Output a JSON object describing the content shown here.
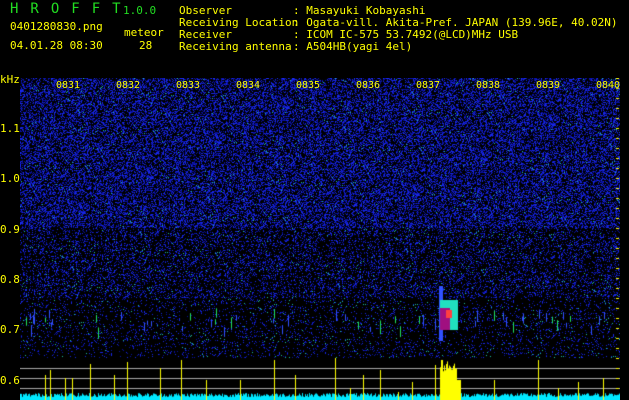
{
  "header": {
    "brand": "HROFFT",
    "version": "1.0.0",
    "filename": "0401280830.png",
    "datetime": "04.01.28 08:30",
    "meteor_label": "meteor",
    "meteor_count": "28"
  },
  "info": [
    {
      "label": "Observer",
      "value": ": Masayuki Kobayashi"
    },
    {
      "label": "Receiving Location",
      "value": ": Ogata-vill. Akita-Pref. JAPAN (139.96E, 40.02N)"
    },
    {
      "label": "Receiver",
      "value": ": ICOM IC-575 53.7492(@LCD)MHz USB"
    },
    {
      "label": "Receiving antenna",
      "value": ": A504HB(yagi 4el)"
    }
  ],
  "spectrogram": {
    "y_unit": "kHz",
    "y_ticks": [
      "1.1",
      "1.0",
      "0.9",
      "0.8",
      "0.7",
      "0.6"
    ],
    "time_ticks": [
      "0831",
      "0832",
      "0833",
      "0834",
      "0835",
      "0836",
      "0837",
      "0838",
      "0839",
      "0840"
    ],
    "colors": {
      "noise": "#1020e0",
      "meteor": "#a01080",
      "echo_bars": "#ffff00",
      "baseline": "#00e8ff",
      "grid": "#aaaaaa",
      "text": "#ffff00"
    }
  }
}
